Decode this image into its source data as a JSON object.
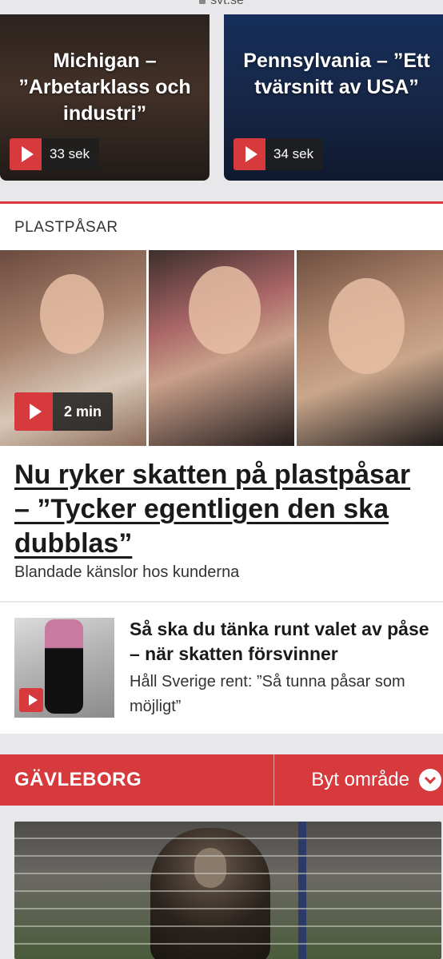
{
  "top_url": "svt.se",
  "cards": [
    {
      "title": "Michigan – ”Arbetarklass och industri”",
      "duration": "33 sek"
    },
    {
      "title": "Pennsylvania – ”Ett tvärsnitt av USA”",
      "duration": "34 sek"
    }
  ],
  "section": {
    "title": "PLASTPÅSAR",
    "hero_duration": "2 min",
    "headline": "Nu ryker skatten på plastpåsar – ”Tycker egentligen den ska dubblas”",
    "subheadline": "Blandade känslor hos kunderna"
  },
  "related": {
    "title": "Så ska du tänka runt valet av påse – när skatten försvinner",
    "subtitle": "Håll Sverige rent: ”Så tunna påsar som möjligt”"
  },
  "region": {
    "name": "GÄVLEBORG",
    "switch_label": "Byt område"
  },
  "colors": {
    "accent": "#d63a3d"
  }
}
